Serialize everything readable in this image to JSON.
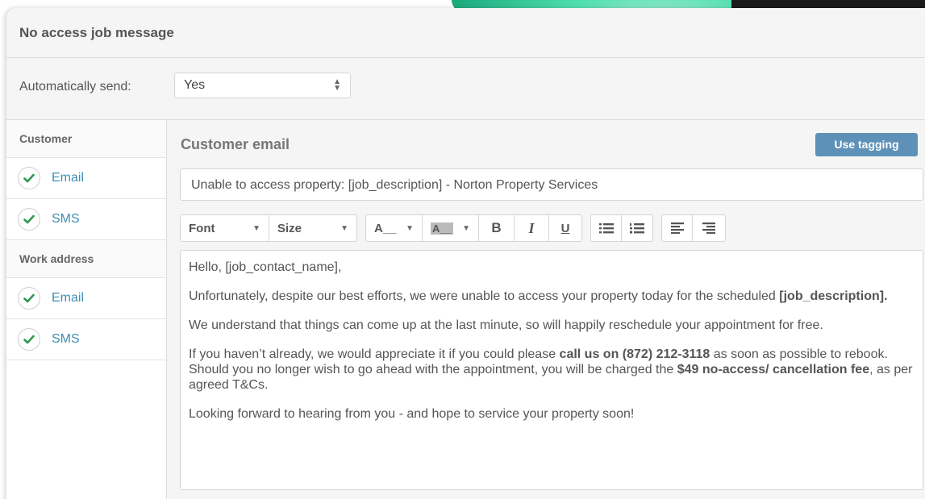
{
  "panel": {
    "title": "No access job message"
  },
  "auto_send": {
    "label": "Automatically send:",
    "value": "Yes"
  },
  "sidebar": {
    "groups": [
      {
        "heading": "Customer",
        "items": [
          {
            "label": "Email",
            "checked": true
          },
          {
            "label": "SMS",
            "checked": true
          }
        ]
      },
      {
        "heading": "Work address",
        "items": [
          {
            "label": "Email",
            "checked": true
          },
          {
            "label": "SMS",
            "checked": true
          }
        ]
      }
    ]
  },
  "main": {
    "title": "Customer email",
    "tag_button": "Use tagging",
    "subject": "Unable to access property: [job_description] - Norton Property Services",
    "toolbar": {
      "font_label": "Font",
      "size_label": "Size",
      "bold_label": "B",
      "italic_label": "I",
      "underline_label": "U",
      "text_color_label": "A__",
      "bg_color_label": "A__"
    },
    "body": {
      "greeting": "Hello, [job_contact_name],",
      "p1_text": "Unfortunately, despite our best efforts, we were unable to access your property today for the scheduled",
      "p1_bold": "[job_description].",
      "p2": "We understand that things can come up at the last minute, so will happily reschedule your appointment for free.",
      "p3_a": "If you haven’t already, we would appreciate it if you could please",
      "p3_b_bold": "call us on (872) 212-3118",
      "p3_c": "as soon as possible to rebook. Should you no longer wish to go ahead with the appointment, you will be charged the",
      "p3_d_bold": "$49 no-access/ cancellation fee",
      "p3_e": ", as per agreed T&Cs.",
      "closing": "Looking forward to hearing from you - and hope to service your property soon!"
    }
  },
  "colors": {
    "accent_link": "#3e8fb3",
    "button_bg": "#5d91b8",
    "check_green": "#2e9a4f"
  }
}
